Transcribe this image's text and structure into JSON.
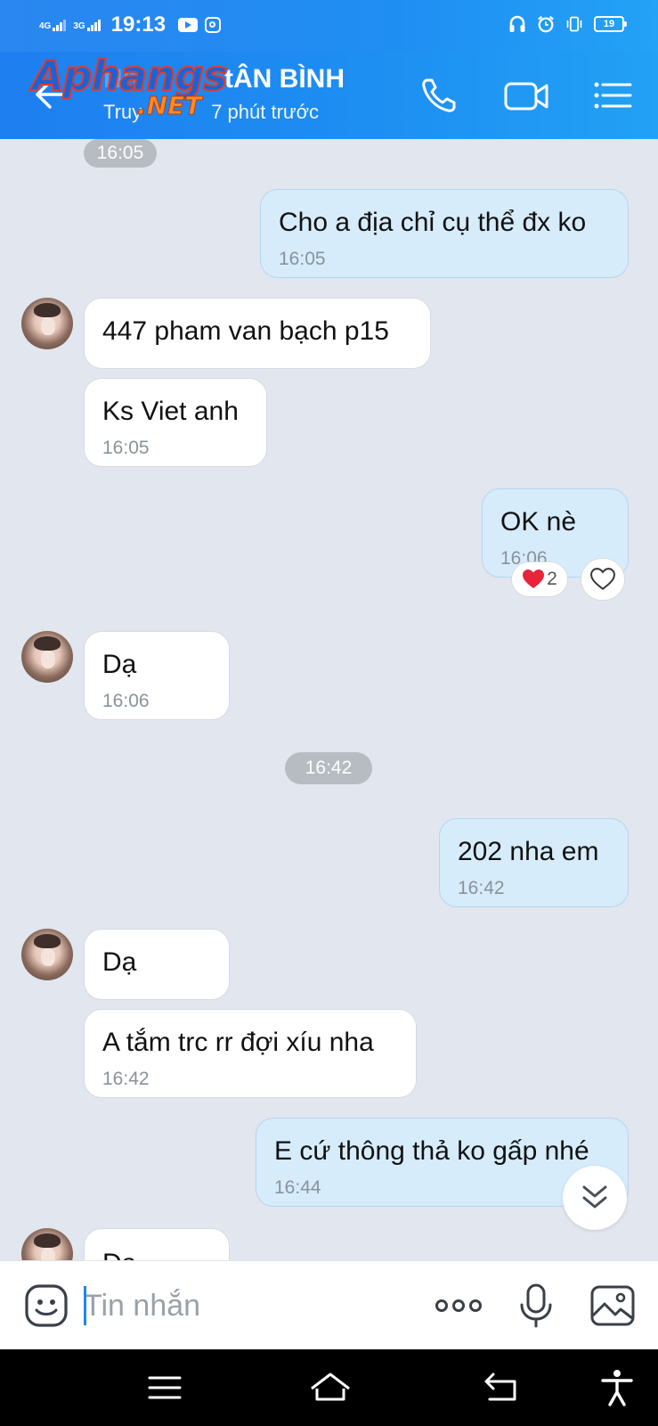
{
  "status_bar": {
    "net1": "4G",
    "net2": "3G",
    "time": "19:13",
    "battery": "19",
    "icons": [
      "youtube-icon",
      "instagram-icon",
      "headphones-icon",
      "alarm-icon",
      "vibrate-icon",
      "battery-icon"
    ]
  },
  "header": {
    "title_visible": "tÂN BÌNH",
    "subtitle_visible": "7 phút trước",
    "subtitle_prefix": "Truy",
    "watermark_main": "Aphangs",
    "watermark_sub": ".NET",
    "icons": [
      "back-arrow-icon",
      "phone-call-icon",
      "video-call-icon",
      "menu-list-icon"
    ]
  },
  "messages": [
    {
      "type": "time",
      "text": "16:05"
    },
    {
      "type": "out",
      "text": "Cho a địa chỉ cụ thể đx ko",
      "time": "16:05"
    },
    {
      "type": "in",
      "text": "447 pham van bạch p15",
      "time": ""
    },
    {
      "type": "in",
      "text": "Ks Viet anh",
      "time": "16:05"
    },
    {
      "type": "out",
      "text": "OK nè",
      "time": "16:06",
      "reaction_count": "2"
    },
    {
      "type": "in",
      "text": "Dạ",
      "time": "16:06"
    },
    {
      "type": "time",
      "text": "16:42"
    },
    {
      "type": "out",
      "text": "202 nha em",
      "time": "16:42"
    },
    {
      "type": "in",
      "text": "Dạ",
      "time": ""
    },
    {
      "type": "in",
      "text": "A tắm trc rr đợi xíu nha",
      "time": "16:42"
    },
    {
      "type": "out",
      "text": "E cứ thông thả ko gấp nhé",
      "time": "16:44"
    },
    {
      "type": "in",
      "text": "Dạ",
      "time": ""
    }
  ],
  "composer": {
    "placeholder": "Tin nhắn",
    "icons": [
      "sticker-icon",
      "more-dots-icon",
      "microphone-icon",
      "image-icon"
    ]
  },
  "colors": {
    "header_blue": "#1e7ff0",
    "outgoing_bubble": "#d6ecfb",
    "incoming_bubble": "#ffffff",
    "chat_bg": "#e2e6ee"
  }
}
